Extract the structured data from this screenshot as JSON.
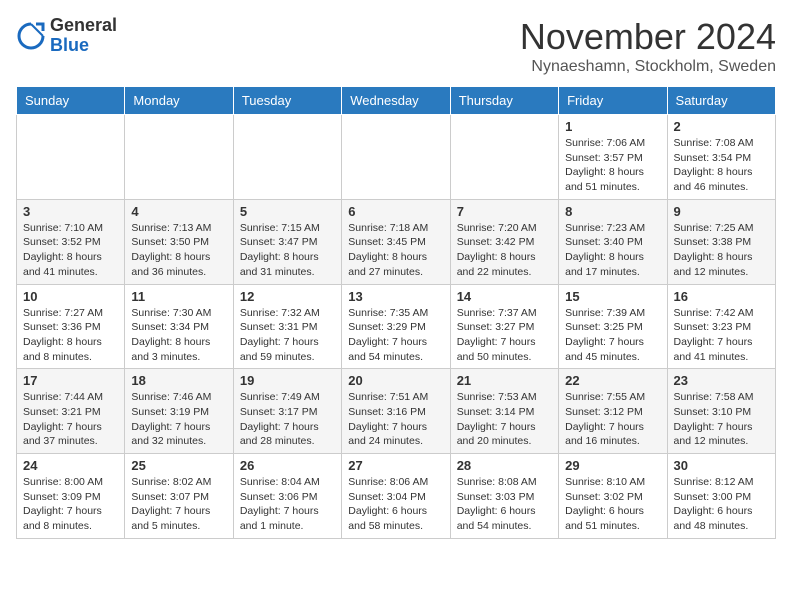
{
  "logo": {
    "general": "General",
    "blue": "Blue"
  },
  "title": "November 2024",
  "location": "Nynaeshamn, Stockholm, Sweden",
  "weekdays": [
    "Sunday",
    "Monday",
    "Tuesday",
    "Wednesday",
    "Thursday",
    "Friday",
    "Saturday"
  ],
  "weeks": [
    [
      {
        "day": "",
        "info": ""
      },
      {
        "day": "",
        "info": ""
      },
      {
        "day": "",
        "info": ""
      },
      {
        "day": "",
        "info": ""
      },
      {
        "day": "",
        "info": ""
      },
      {
        "day": "1",
        "info": "Sunrise: 7:06 AM\nSunset: 3:57 PM\nDaylight: 8 hours and 51 minutes."
      },
      {
        "day": "2",
        "info": "Sunrise: 7:08 AM\nSunset: 3:54 PM\nDaylight: 8 hours and 46 minutes."
      }
    ],
    [
      {
        "day": "3",
        "info": "Sunrise: 7:10 AM\nSunset: 3:52 PM\nDaylight: 8 hours and 41 minutes."
      },
      {
        "day": "4",
        "info": "Sunrise: 7:13 AM\nSunset: 3:50 PM\nDaylight: 8 hours and 36 minutes."
      },
      {
        "day": "5",
        "info": "Sunrise: 7:15 AM\nSunset: 3:47 PM\nDaylight: 8 hours and 31 minutes."
      },
      {
        "day": "6",
        "info": "Sunrise: 7:18 AM\nSunset: 3:45 PM\nDaylight: 8 hours and 27 minutes."
      },
      {
        "day": "7",
        "info": "Sunrise: 7:20 AM\nSunset: 3:42 PM\nDaylight: 8 hours and 22 minutes."
      },
      {
        "day": "8",
        "info": "Sunrise: 7:23 AM\nSunset: 3:40 PM\nDaylight: 8 hours and 17 minutes."
      },
      {
        "day": "9",
        "info": "Sunrise: 7:25 AM\nSunset: 3:38 PM\nDaylight: 8 hours and 12 minutes."
      }
    ],
    [
      {
        "day": "10",
        "info": "Sunrise: 7:27 AM\nSunset: 3:36 PM\nDaylight: 8 hours and 8 minutes."
      },
      {
        "day": "11",
        "info": "Sunrise: 7:30 AM\nSunset: 3:34 PM\nDaylight: 8 hours and 3 minutes."
      },
      {
        "day": "12",
        "info": "Sunrise: 7:32 AM\nSunset: 3:31 PM\nDaylight: 7 hours and 59 minutes."
      },
      {
        "day": "13",
        "info": "Sunrise: 7:35 AM\nSunset: 3:29 PM\nDaylight: 7 hours and 54 minutes."
      },
      {
        "day": "14",
        "info": "Sunrise: 7:37 AM\nSunset: 3:27 PM\nDaylight: 7 hours and 50 minutes."
      },
      {
        "day": "15",
        "info": "Sunrise: 7:39 AM\nSunset: 3:25 PM\nDaylight: 7 hours and 45 minutes."
      },
      {
        "day": "16",
        "info": "Sunrise: 7:42 AM\nSunset: 3:23 PM\nDaylight: 7 hours and 41 minutes."
      }
    ],
    [
      {
        "day": "17",
        "info": "Sunrise: 7:44 AM\nSunset: 3:21 PM\nDaylight: 7 hours and 37 minutes."
      },
      {
        "day": "18",
        "info": "Sunrise: 7:46 AM\nSunset: 3:19 PM\nDaylight: 7 hours and 32 minutes."
      },
      {
        "day": "19",
        "info": "Sunrise: 7:49 AM\nSunset: 3:17 PM\nDaylight: 7 hours and 28 minutes."
      },
      {
        "day": "20",
        "info": "Sunrise: 7:51 AM\nSunset: 3:16 PM\nDaylight: 7 hours and 24 minutes."
      },
      {
        "day": "21",
        "info": "Sunrise: 7:53 AM\nSunset: 3:14 PM\nDaylight: 7 hours and 20 minutes."
      },
      {
        "day": "22",
        "info": "Sunrise: 7:55 AM\nSunset: 3:12 PM\nDaylight: 7 hours and 16 minutes."
      },
      {
        "day": "23",
        "info": "Sunrise: 7:58 AM\nSunset: 3:10 PM\nDaylight: 7 hours and 12 minutes."
      }
    ],
    [
      {
        "day": "24",
        "info": "Sunrise: 8:00 AM\nSunset: 3:09 PM\nDaylight: 7 hours and 8 minutes."
      },
      {
        "day": "25",
        "info": "Sunrise: 8:02 AM\nSunset: 3:07 PM\nDaylight: 7 hours and 5 minutes."
      },
      {
        "day": "26",
        "info": "Sunrise: 8:04 AM\nSunset: 3:06 PM\nDaylight: 7 hours and 1 minute."
      },
      {
        "day": "27",
        "info": "Sunrise: 8:06 AM\nSunset: 3:04 PM\nDaylight: 6 hours and 58 minutes."
      },
      {
        "day": "28",
        "info": "Sunrise: 8:08 AM\nSunset: 3:03 PM\nDaylight: 6 hours and 54 minutes."
      },
      {
        "day": "29",
        "info": "Sunrise: 8:10 AM\nSunset: 3:02 PM\nDaylight: 6 hours and 51 minutes."
      },
      {
        "day": "30",
        "info": "Sunrise: 8:12 AM\nSunset: 3:00 PM\nDaylight: 6 hours and 48 minutes."
      }
    ]
  ]
}
